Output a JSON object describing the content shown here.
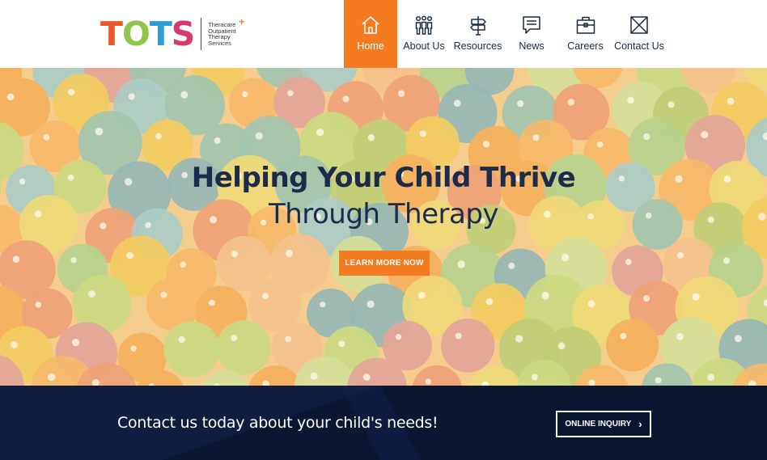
{
  "logo": {
    "letters": [
      "T",
      "O",
      "T",
      "S"
    ],
    "letter_colors": [
      "#e8562a",
      "#8fc64a",
      "#2e9cd6",
      "#d63a6c"
    ],
    "tagline": [
      "Theracare",
      "Outpatient",
      "Therapy",
      "Services"
    ],
    "plus_mark": "+"
  },
  "nav": {
    "items": [
      {
        "label": "Home",
        "icon": "home-icon",
        "active": true
      },
      {
        "label": "About Us",
        "icon": "people-icon",
        "active": false
      },
      {
        "label": "Resources",
        "icon": "signpost-icon",
        "active": false
      },
      {
        "label": "News",
        "icon": "chat-bubble-icon",
        "active": false
      },
      {
        "label": "Careers",
        "icon": "briefcase-icon",
        "active": false
      },
      {
        "label": "Contact Us",
        "icon": "envelope-icon",
        "active": false
      }
    ]
  },
  "hero": {
    "title": "Helping Your Child Thrive",
    "subtitle": "Through Therapy",
    "button_label": "LEARN MORE NOW"
  },
  "cta": {
    "text": "Contact us today about your child's needs!",
    "button_label": "ONLINE INQUIRY",
    "button_icon": "chevron-right-icon"
  },
  "colors": {
    "accent": "#f47b20",
    "navy": "#0f1d3e",
    "heading": "#1c2b4a"
  }
}
